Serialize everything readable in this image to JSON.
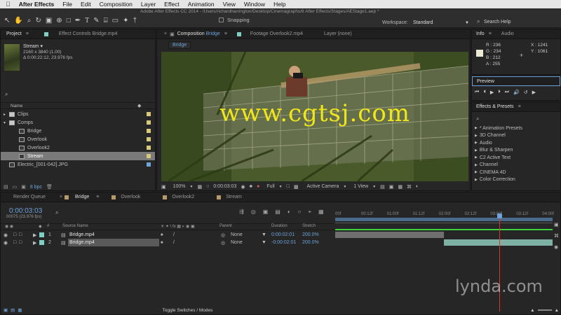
{
  "menubar": {
    "apple": "",
    "app_name": "After Effects",
    "items": [
      "File",
      "Edit",
      "Composition",
      "Layer",
      "Effect",
      "Animation",
      "View",
      "Window",
      "Help"
    ]
  },
  "toolbar": {
    "window_title": "Adobe After Effects CC 2014 - /Users/richardharrington/Desktop/Cinemagraphs/6 After Effects/Stages/AEStage1.aep *",
    "snapping_label": "Snapping",
    "workspace_label": "Workspace:",
    "workspace_value": "Standard",
    "search_help_placeholder": "Search Help"
  },
  "project_panel": {
    "tab_project": "Project",
    "tab_effect_controls": "Effect Controls Bridge.mp4",
    "preview_name": "Stream ▾",
    "preview_info1": "2160 x 3840 (1.00)",
    "preview_info2": "Δ 0:00:22:12, 23.976 fps",
    "search_placeholder": "",
    "col_name": "Name",
    "items": [
      {
        "label": "Clips",
        "indent": 0,
        "type": "folder"
      },
      {
        "label": "Comps",
        "indent": 0,
        "type": "folder"
      },
      {
        "label": "Bridge",
        "indent": 1,
        "type": "comp"
      },
      {
        "label": "Overlook",
        "indent": 1,
        "type": "comp"
      },
      {
        "label": "Overlook2",
        "indent": 1,
        "type": "comp"
      },
      {
        "label": "Stream",
        "indent": 1,
        "type": "comp",
        "selected": true
      },
      {
        "label": "Electric_[001-042].JPG",
        "indent": 0,
        "type": "file"
      }
    ],
    "bpc_label": "8 bpc"
  },
  "comp_panel": {
    "tab_comp_prefix": "Composition",
    "tab_comp_name": "Bridge",
    "tab_footage": "Footage Overlook2.mp4",
    "tab_layer": "Layer (none)",
    "breadcrumb": "Bridge",
    "watermark": "www.cgtsj.com",
    "zoom": "100%",
    "timecode": "0:00:03:03",
    "resolution": "Full",
    "camera": "Active Camera",
    "views": "1 View"
  },
  "info_panel": {
    "tab_info": "Info",
    "tab_audio": "Audio",
    "r": "R : 236",
    "g": "G : 234",
    "b": "B : 212",
    "a": "A : 255",
    "x": "X : 1241",
    "y": "Y : 1061",
    "swatch_color": "#ecead4"
  },
  "preview_panel": {
    "title": "Preview"
  },
  "effects_panel": {
    "title": "Effects & Presets",
    "search_placeholder": "",
    "items": [
      "* Animation Presets",
      "3D Channel",
      "Audio",
      "Blur & Sharpen",
      "C2 Active Text",
      "Channel",
      "CINEMA 4D",
      "Color Correction"
    ]
  },
  "timeline": {
    "tab_render_queue": "Render Queue",
    "tab_bridge": "Bridge",
    "tab_overlook": "Overlook",
    "tab_overlook2": "Overlook2",
    "tab_stream": "Stream",
    "timecode": "0:00:03:03",
    "fps": "00075 (23.976 fps)",
    "col_source_name": "Source Name",
    "col_parent": "Parent",
    "col_duration": "Duration",
    "col_stretch": "Stretch",
    "ruler_labels": [
      "00f",
      "00:12f",
      "01:00f",
      "01:12f",
      "02:00f",
      "02:12f",
      "03:00f",
      "03:12f",
      "04:00f"
    ],
    "layers": [
      {
        "num": "1",
        "name": "Bridge.mp4",
        "parent": "None",
        "duration": "0:00:02:01",
        "stretch": "200.0%",
        "bar_start": 0.0,
        "bar_end": 0.5
      },
      {
        "num": "2",
        "name": "Bridge.mp4",
        "parent": "None",
        "duration": "-0:00:02:01",
        "stretch": "200.0%",
        "bar_start": 0.5,
        "bar_end": 1.0
      }
    ],
    "toggle_label": "Toggle Switches / Modes",
    "playhead_fraction": 0.755
  },
  "watermark_corner": "lynda.com"
}
